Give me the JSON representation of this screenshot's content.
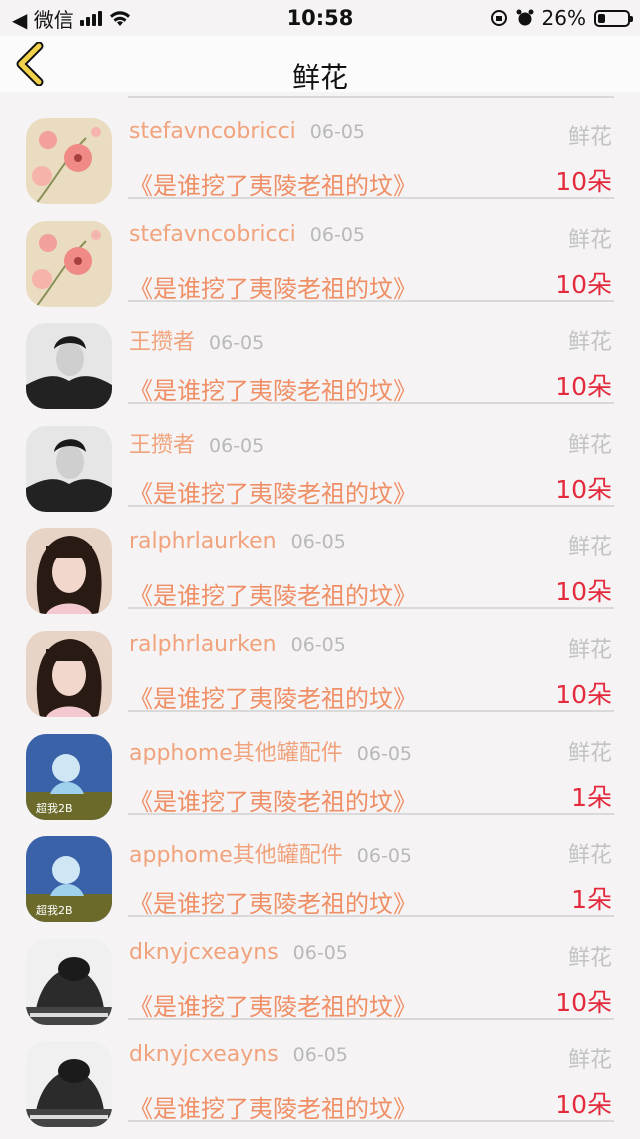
{
  "status_bar": {
    "back_app": "◀ 微信",
    "time": "10:58",
    "battery": "26%"
  },
  "nav": {
    "title": "鲜花"
  },
  "colors": {
    "name": "#f0a37c",
    "title": "#ef8f66",
    "count": "#e32b3d"
  },
  "rows": [
    {
      "name": "stefavncobricci",
      "date": "06-05",
      "kind": "鲜花",
      "title": "《是谁挖了夷陵老祖的坟》",
      "count": "10朵",
      "avatar_style": "flowers"
    },
    {
      "name": "stefavncobricci",
      "date": "06-05",
      "kind": "鲜花",
      "title": "《是谁挖了夷陵老祖的坟》",
      "count": "10朵",
      "avatar_style": "flowers"
    },
    {
      "name": "王攒者",
      "date": "06-05",
      "kind": "鲜花",
      "title": "《是谁挖了夷陵老祖的坟》",
      "count": "10朵",
      "avatar_style": "man"
    },
    {
      "name": "王攒者",
      "date": "06-05",
      "kind": "鲜花",
      "title": "《是谁挖了夷陵老祖的坟》",
      "count": "10朵",
      "avatar_style": "man"
    },
    {
      "name": "ralphrlaurken",
      "date": "06-05",
      "kind": "鲜花",
      "title": "《是谁挖了夷陵老祖的坟》",
      "count": "10朵",
      "avatar_style": "girl"
    },
    {
      "name": "ralphrlaurken",
      "date": "06-05",
      "kind": "鲜花",
      "title": "《是谁挖了夷陵老祖的坟》",
      "count": "10朵",
      "avatar_style": "girl"
    },
    {
      "name": "apphome其他罐配件",
      "date": "06-05",
      "kind": "鲜花",
      "title": "《是谁挖了夷陵老祖的坟》",
      "count": "1朵",
      "avatar_style": "blue"
    },
    {
      "name": "apphome其他罐配件",
      "date": "06-05",
      "kind": "鲜花",
      "title": "《是谁挖了夷陵老祖的坟》",
      "count": "1朵",
      "avatar_style": "blue"
    },
    {
      "name": "dknyjcxeayns",
      "date": "06-05",
      "kind": "鲜花",
      "title": "《是谁挖了夷陵老祖的坟》",
      "count": "10朵",
      "avatar_style": "bw"
    },
    {
      "name": "dknyjcxeayns",
      "date": "06-05",
      "kind": "鲜花",
      "title": "《是谁挖了夷陵老祖的坟》",
      "count": "10朵",
      "avatar_style": "bw"
    }
  ]
}
